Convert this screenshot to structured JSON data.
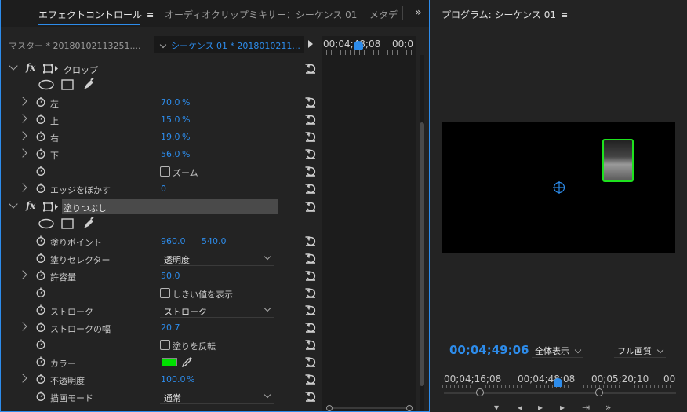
{
  "effect_controls": {
    "tabs": [
      {
        "label": "エフェクトコントロール",
        "active": true,
        "menu": "≡"
      },
      {
        "label": "オーディオクリップミキサー：シーケンス 01",
        "active": false
      },
      {
        "label": "メタデ",
        "active": false
      }
    ],
    "tabs_overflow": "»",
    "master_label": "マスター * 20180102113251....",
    "sequence_label": "シーケンス 01 * 2018010211...",
    "ruler": {
      "tc_left": "00;04;48;08",
      "tc_right": "00;0"
    },
    "crop": {
      "name": "クロップ",
      "left": {
        "label": "左",
        "value": "70.0",
        "unit": "%"
      },
      "top": {
        "label": "上",
        "value": "15.0",
        "unit": "%"
      },
      "right": {
        "label": "右",
        "value": "19.0",
        "unit": "%"
      },
      "bottom": {
        "label": "下",
        "value": "56.0",
        "unit": "%"
      },
      "zoom_label": "ズーム",
      "feather": {
        "label": "エッジをぼかす",
        "value": "0"
      }
    },
    "fill": {
      "name": "塗りつぶし",
      "fill_point": {
        "label": "塗りポイント",
        "x": "960.0",
        "y": "540.0"
      },
      "fill_selector": {
        "label": "塗りセレクター",
        "value": "透明度"
      },
      "tolerance": {
        "label": "許容量",
        "value": "50.0"
      },
      "show_threshold_label": "しきい値を表示",
      "stroke": {
        "label": "ストローク",
        "value": "ストローク"
      },
      "stroke_width": {
        "label": "ストロークの幅",
        "value": "20.7"
      },
      "invert_label": "塗りを反転",
      "color": {
        "label": "カラー",
        "value": "#00e000"
      },
      "opacity": {
        "label": "不透明度",
        "value": "100.0",
        "unit": "%"
      },
      "blend_mode": {
        "label": "描画モード",
        "value": "通常"
      }
    }
  },
  "program_monitor": {
    "title": "プログラム: シーケンス 01",
    "menu": "≡",
    "timecode": "00;04;49;06",
    "zoom_select": "全体表示",
    "quality_select": "フル画質",
    "ruler_tcs": [
      "00;04;16;08",
      "00;04;48;08",
      "00;05;20;10",
      "00"
    ]
  },
  "colors": {
    "accent": "#2d8ceb",
    "fill_color": "#00e000",
    "panel_bg": "#232323"
  }
}
